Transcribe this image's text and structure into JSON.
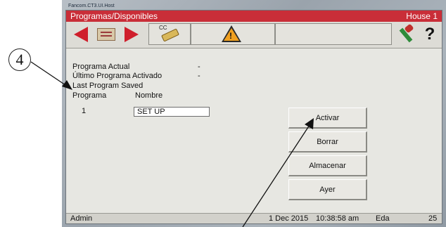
{
  "window": {
    "title": "Fancom.CT3.UI.Host"
  },
  "header": {
    "title": "Programas/Disponibles",
    "location": "House 1"
  },
  "toolbar": {
    "icons": [
      "arrow-left-icon",
      "program-list-icon",
      "arrow-right-icon",
      "cc-key-icon",
      "warning-icon",
      "tools-icon",
      "help-icon"
    ],
    "help_label": "?",
    "cc_label": "CC"
  },
  "info": {
    "current_program_label": "Programa Actual",
    "current_program_value": "-",
    "last_activated_label": "Último Programa Activado",
    "last_activated_value": "-",
    "last_saved_label": "Last Program Saved",
    "col_program": "Programa",
    "col_name": "Nombre"
  },
  "programs": [
    {
      "number": "1",
      "name": "SET UP"
    }
  ],
  "actions": {
    "activate": "Activar",
    "delete": "Borrar",
    "store": "Almacenar",
    "yesterday": "Ayer"
  },
  "status": {
    "user": "Admin",
    "date": "1 Dec 2015",
    "time": "10:38:58 am",
    "unit": "Eda",
    "count": "25"
  },
  "callout": {
    "number": "4"
  },
  "colors": {
    "header": "#c92e38",
    "arrow": "#cf1f2c",
    "screen": "#e7e7e2"
  }
}
